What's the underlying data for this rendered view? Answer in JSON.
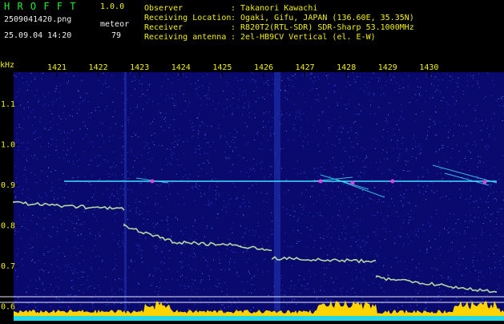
{
  "app": {
    "logo": "H R O F F T",
    "version": "1.0.0"
  },
  "capture": {
    "filename": "2509041420.png",
    "datetime": "25.09.04 14:20",
    "meteor_label": "meteor",
    "meteor_count": "79"
  },
  "info": [
    {
      "label": "Observer",
      "value": ": Takanori Kawachi"
    },
    {
      "label": "Receiving Location",
      "value": ": Ogaki, Gifu, JAPAN (136.60E, 35.35N)"
    },
    {
      "label": "Receiver",
      "value": ": R820T2(RTL-SDR) SDR-Sharp 53.1000MHz"
    },
    {
      "label": "Receiving antenna",
      "value": ": 2el-HB9CV Vertical (el. E-W)"
    }
  ],
  "spectrogram": {
    "y_unit": "kHz",
    "time_ticks": [
      "1421",
      "1422",
      "1423",
      "1424",
      "1425",
      "1426",
      "1427",
      "1428",
      "1429",
      "1430"
    ],
    "freq_ticks": [
      "1.1",
      "1.0",
      "0.9",
      "0.8",
      "0.7",
      "0.6"
    ],
    "colors": {
      "background": "#0a0a6e",
      "noise": "#2f3fd6",
      "grid": "#000000",
      "tick_text": "#f2ee1c",
      "carrier": "#40e0ff",
      "meteor": "#e040e0",
      "ref_line": "#e8e8ff",
      "bottom_band": "#ffd400",
      "baseline": "#1fd8e8"
    }
  }
}
